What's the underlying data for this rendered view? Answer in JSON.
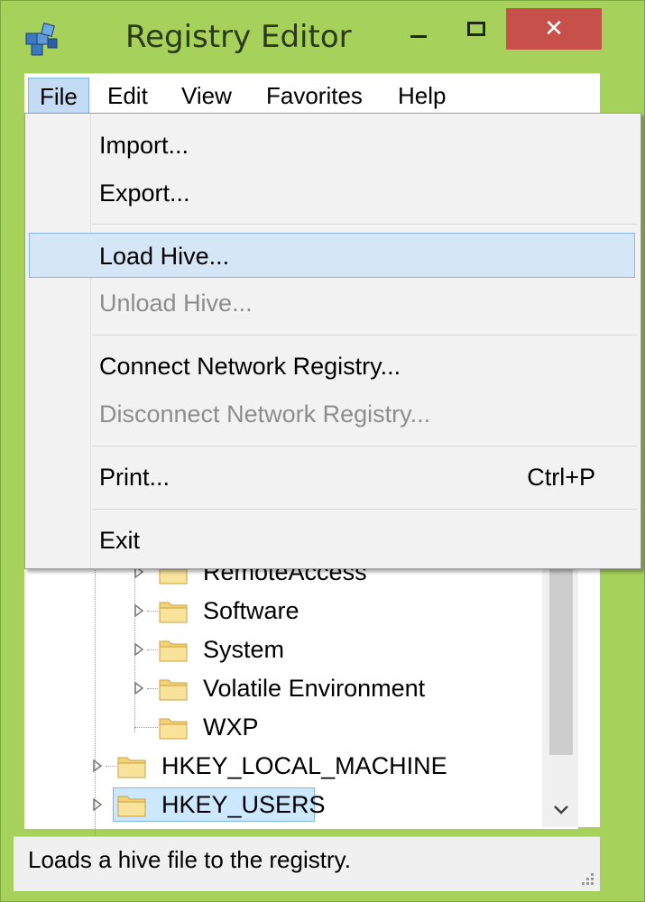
{
  "window": {
    "title": "Registry Editor",
    "close_glyph": "✕",
    "icons": {
      "app": "registry-editor-icon",
      "minimize": "minimize-icon",
      "maximize": "maximize-icon",
      "close": "close-icon"
    },
    "colors": {
      "close_button": "#c7504a",
      "selection": "#cce8ff",
      "menu_highlight": "#d5e6f7"
    }
  },
  "menubar": {
    "items": [
      {
        "label": "File",
        "open": true
      },
      {
        "label": "Edit"
      },
      {
        "label": "View"
      },
      {
        "label": "Favorites"
      },
      {
        "label": "Help"
      }
    ]
  },
  "file_menu": {
    "items": [
      {
        "label": "Import...",
        "enabled": true
      },
      {
        "label": "Export...",
        "enabled": true
      },
      {
        "label": "Load Hive...",
        "enabled": true,
        "highlighted": true
      },
      {
        "label": "Unload Hive...",
        "enabled": false
      },
      {
        "label": "Connect Network Registry...",
        "enabled": true
      },
      {
        "label": "Disconnect Network Registry...",
        "enabled": false
      },
      {
        "label": "Print...",
        "shortcut": "Ctrl+P",
        "enabled": true
      },
      {
        "label": "Exit",
        "enabled": true
      }
    ]
  },
  "tree": {
    "items": [
      {
        "label": "RemoteAccess"
      },
      {
        "label": "Software"
      },
      {
        "label": "System"
      },
      {
        "label": "Volatile Environment"
      },
      {
        "label": "WXP"
      },
      {
        "label": "HKEY_LOCAL_MACHINE"
      },
      {
        "label": "HKEY_USERS",
        "selected": true
      }
    ]
  },
  "statusbar": {
    "text": "Loads a hive file to the registry."
  }
}
